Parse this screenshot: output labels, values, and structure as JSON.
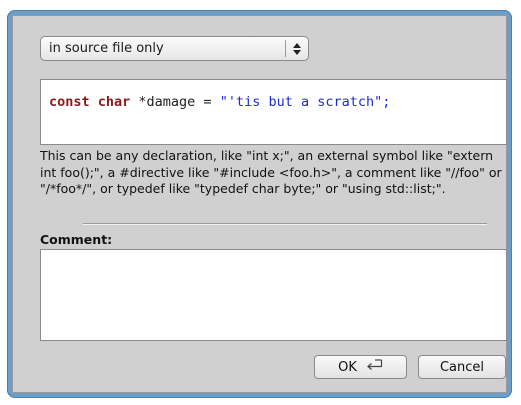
{
  "scope_select": {
    "selected": "in source file only"
  },
  "code": {
    "keyword": "const char",
    "declaration": " *damage = ",
    "string_literal": "\"'tis but a scratch\";"
  },
  "help_text": "This can be any declaration, like \"int x;\", an external symbol like \"extern int foo();\", a #directive like \"#include <foo.h>\", a comment like \"//foo\" or \"/*foo*/\", or typedef like \"typedef char byte;\" or \"using std::list;\".",
  "comment": {
    "label": "Comment:",
    "value": ""
  },
  "buttons": {
    "ok_label": "OK",
    "ok_icon": "return-key-icon",
    "cancel_label": "Cancel"
  },
  "colors": {
    "frame": "#6b9ec8",
    "dialog_bg": "#d0d0d0",
    "keyword": "#8b1a1a",
    "string": "#1f2bd6"
  }
}
